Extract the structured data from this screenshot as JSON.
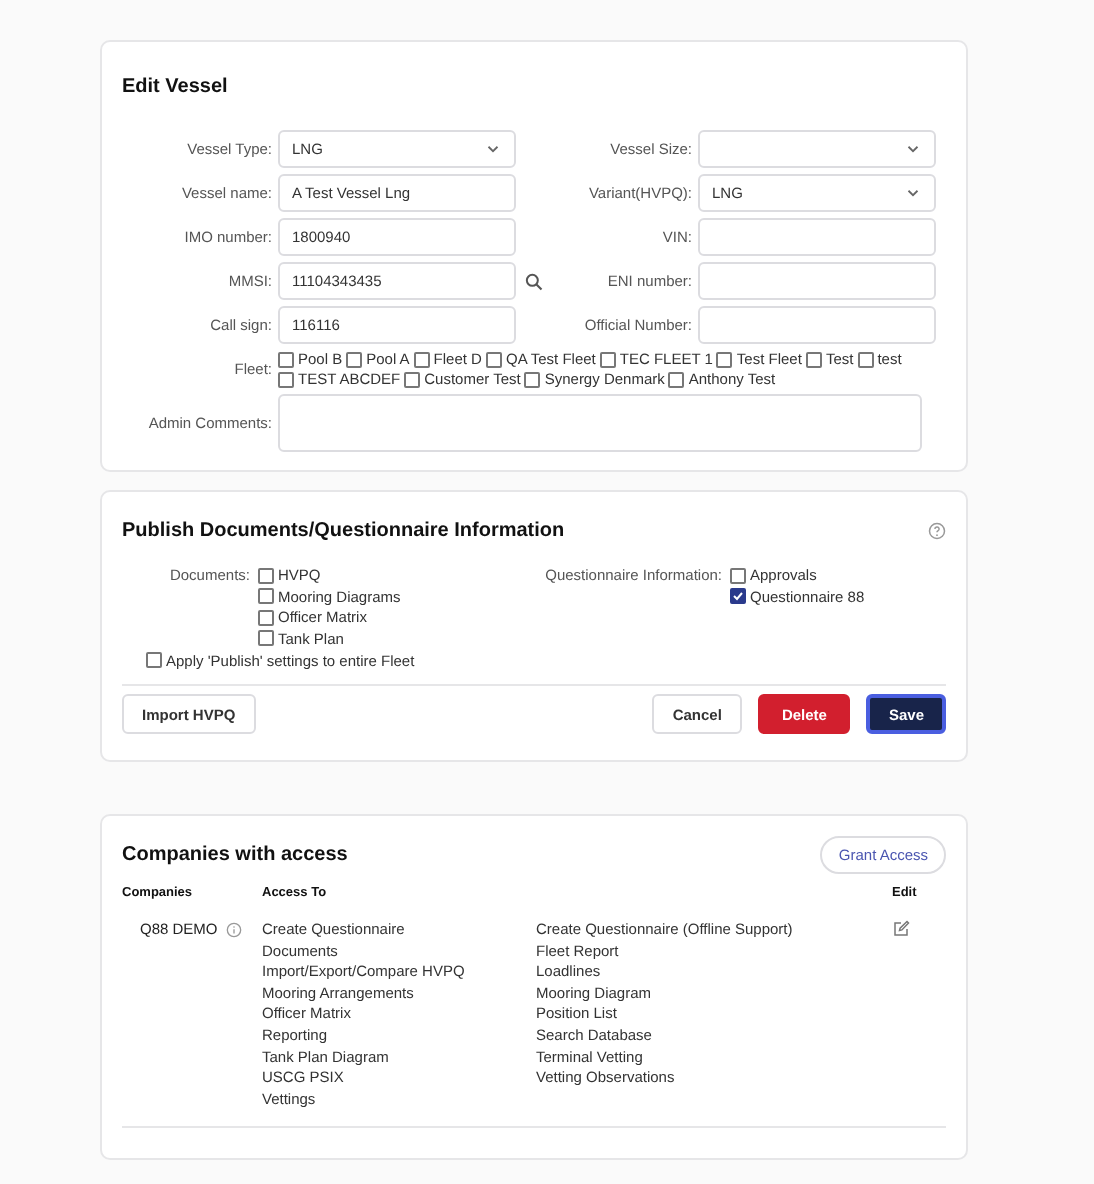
{
  "edit_vessel": {
    "title": "Edit Vessel",
    "rows": [
      {
        "left": {
          "label": "Vessel Type:",
          "kind": "select",
          "value": "LNG"
        },
        "right": {
          "label": "Vessel Size:",
          "kind": "select"
        }
      },
      {
        "left": {
          "label": "Vessel name:",
          "kind": "text",
          "value": "A Test Vessel Lng"
        },
        "right": {
          "label": "Variant(HVPQ):",
          "kind": "select",
          "value": "LNG"
        }
      },
      {
        "left": {
          "label": "IMO number:",
          "kind": "text",
          "value": "1800940"
        },
        "right": {
          "label": "VIN:",
          "kind": "text"
        }
      },
      {
        "left": {
          "label": "MMSI:",
          "kind": "search",
          "value": "11104343435"
        },
        "right": {
          "label": "ENI number:",
          "kind": "text"
        }
      },
      {
        "left": {
          "label": "Call sign:",
          "kind": "text",
          "value": "116116"
        },
        "right": {
          "label": "Official Number:",
          "kind": "text"
        }
      }
    ],
    "fleet": {
      "label": "Fleet:",
      "options": [
        {
          "label": "Pool B",
          "checked": false
        },
        {
          "label": "Pool A",
          "checked": false
        },
        {
          "label": "Fleet D",
          "checked": false
        },
        {
          "label": "QA Test Fleet",
          "checked": false
        },
        {
          "label": "TEC FLEET 1",
          "checked": false
        },
        {
          "label": "Test Fleet",
          "checked": false
        },
        {
          "label": "Test",
          "checked": false
        },
        {
          "label": "test",
          "checked": false
        },
        {
          "label": "TEST ABCDEF",
          "checked": false
        },
        {
          "label": "Customer Test",
          "checked": false
        },
        {
          "label": "Synergy Denmark",
          "checked": false
        },
        {
          "label": "Anthony Test",
          "checked": false
        }
      ]
    },
    "admin_comments": {
      "label": "Admin Comments:"
    }
  },
  "publish": {
    "title": "Publish Documents/Questionnaire Information",
    "documents": {
      "label": "Documents:",
      "options": [
        {
          "label": "HVPQ",
          "checked": false
        },
        {
          "label": "Mooring Diagrams",
          "checked": false
        },
        {
          "label": "Officer Matrix",
          "checked": false
        },
        {
          "label": "Tank Plan",
          "checked": false
        }
      ]
    },
    "questionnaire_information": {
      "label": "Questionnaire Information:",
      "options": [
        {
          "label": "Approvals",
          "checked": false
        },
        {
          "label": "Questionnaire 88",
          "checked": true
        }
      ]
    },
    "apply_to_fleet": {
      "label": "Apply 'Publish' settings to entire Fleet",
      "checked": false
    },
    "buttons": [
      {
        "label": "Import HVPQ",
        "kind": "default"
      },
      {
        "label": "Cancel",
        "kind": "default"
      },
      {
        "label": "Delete",
        "kind": "danger"
      },
      {
        "label": "Save",
        "kind": "primary"
      }
    ]
  },
  "companies": {
    "title": "Companies with access",
    "grant_button": "Grant Access",
    "columns": [
      "Companies",
      "Access To",
      "Edit"
    ],
    "rows": [
      {
        "company": "Q88 DEMO",
        "access_left": [
          "Create Questionnaire",
          "Documents",
          "Import/Export/Compare HVPQ",
          "Mooring Arrangements",
          "Officer Matrix",
          "Reporting",
          "Tank Plan Diagram",
          "USCG PSIX",
          "Vettings"
        ],
        "access_right": [
          "Create Questionnaire (Offline Support)",
          "Fleet Report",
          "Loadlines",
          "Mooring Diagram",
          "Position List",
          "Search Database",
          "Terminal Vetting",
          "Vetting Observations"
        ]
      }
    ]
  }
}
